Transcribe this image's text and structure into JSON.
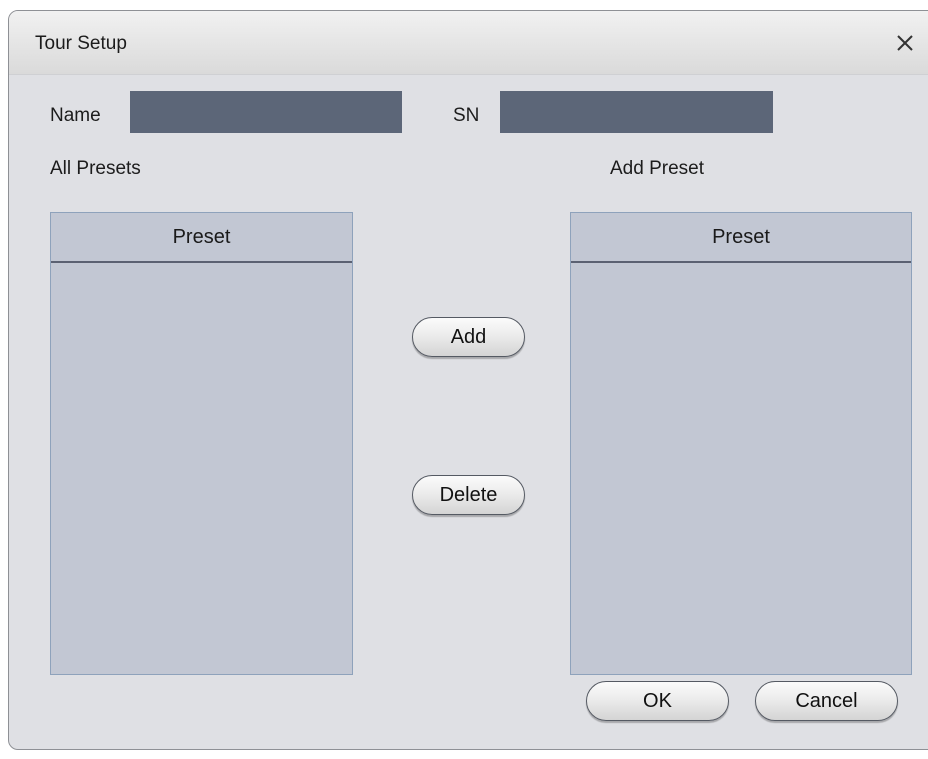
{
  "dialog": {
    "title": "Tour Setup",
    "close_icon": "close-icon"
  },
  "form": {
    "name_label": "Name",
    "name_value": "",
    "sn_label": "SN",
    "sn_value": ""
  },
  "left_panel": {
    "heading": "All Presets",
    "column_header": "Preset",
    "items": []
  },
  "right_panel": {
    "heading": "Add Preset",
    "column_header": "Preset",
    "items": []
  },
  "actions": {
    "add_label": "Add",
    "delete_label": "Delete",
    "ok_label": "OK",
    "cancel_label": "Cancel"
  },
  "colors": {
    "dialog_bg": "#dfe0e4",
    "field_bg": "#5c6678",
    "list_bg": "#c2c7d3"
  }
}
